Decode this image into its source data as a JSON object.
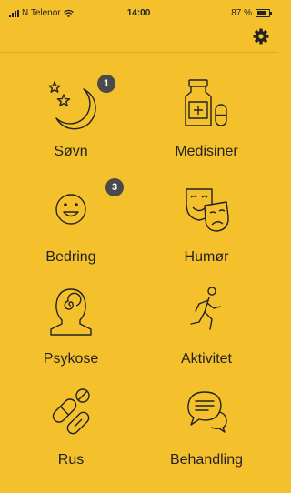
{
  "status_bar": {
    "carrier": "N Telenor",
    "time": "14:00",
    "battery": "87 %"
  },
  "tiles": [
    {
      "label": "Søvn",
      "icon": "moon-stars-icon",
      "badge": "1"
    },
    {
      "label": "Medisiner",
      "icon": "medicine-bottle-icon",
      "badge": ""
    },
    {
      "label": "Bedring",
      "icon": "smiley-face-icon",
      "badge": "3"
    },
    {
      "label": "Humør",
      "icon": "theater-masks-icon",
      "badge": ""
    },
    {
      "label": "Psykose",
      "icon": "head-spiral-icon",
      "badge": ""
    },
    {
      "label": "Aktivitet",
      "icon": "running-person-icon",
      "badge": ""
    },
    {
      "label": "Rus",
      "icon": "pills-icon",
      "badge": ""
    },
    {
      "label": "Behandling",
      "icon": "speech-bubbles-icon",
      "badge": ""
    }
  ],
  "colors": {
    "background": "#F4C12C",
    "badge": "#4A4A4A",
    "ink": "#222222"
  }
}
